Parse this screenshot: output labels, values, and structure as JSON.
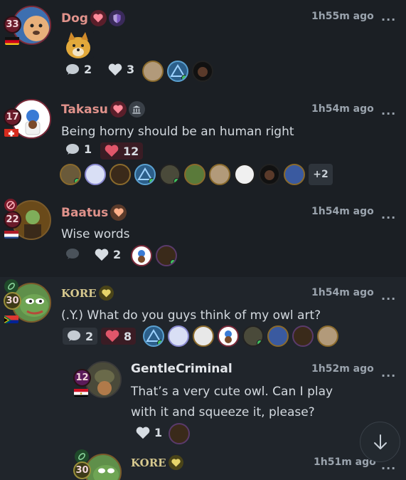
{
  "posts": [
    {
      "username": "Dog",
      "level": "33",
      "flag": "Germany",
      "badges": [
        "heart-badge-icon",
        "shield-badge-icon"
      ],
      "time": "1h55m ago",
      "text": "",
      "has_image": true,
      "comments": "2",
      "likes": "3",
      "reactors_more": ""
    },
    {
      "username": "Takasu",
      "level": "17",
      "flag": "Switzerland",
      "badges": [
        "heart-badge-icon",
        "bank-badge-icon"
      ],
      "time": "1h54m ago",
      "text": "Being horny should be an human right",
      "comments": "1",
      "likes": "12",
      "reactors_more": "+2"
    },
    {
      "username": "Baatus",
      "level": "22",
      "flag": "Netherlands",
      "badges": [
        "heart-badge-icon"
      ],
      "time": "1h54m ago",
      "text": "Wise words",
      "comments": "",
      "likes": "2",
      "reactors_more": ""
    },
    {
      "username": "KORE",
      "level": "30",
      "flag": "South Africa",
      "badges": [
        "heart-badge-icon"
      ],
      "time": "1h54m ago",
      "text": "(.Y.) What do you guys think of my owl art?",
      "comments": "2",
      "likes": "8",
      "reactors_more": ""
    },
    {
      "username": "GentleCriminal",
      "level": "12",
      "flag": "Egypt",
      "badges": [],
      "time": "1h52m ago",
      "text_line1": "That’s a very cute owl. Can I play",
      "text_line2": "with it and squeeze it, please?",
      "likes": "1",
      "reactors_more": ""
    },
    {
      "username": "KORE",
      "level": "30",
      "flag": "South Africa",
      "badges": [
        "heart-badge-icon"
      ],
      "time": "1h51m ago"
    }
  ],
  "menu_label": "...",
  "colors": {
    "background": "#1b1f24",
    "highlight_background": "#20252b",
    "username_red": "#e0928b",
    "liked_background": "#3a1c24",
    "online": "#3fc35e"
  }
}
